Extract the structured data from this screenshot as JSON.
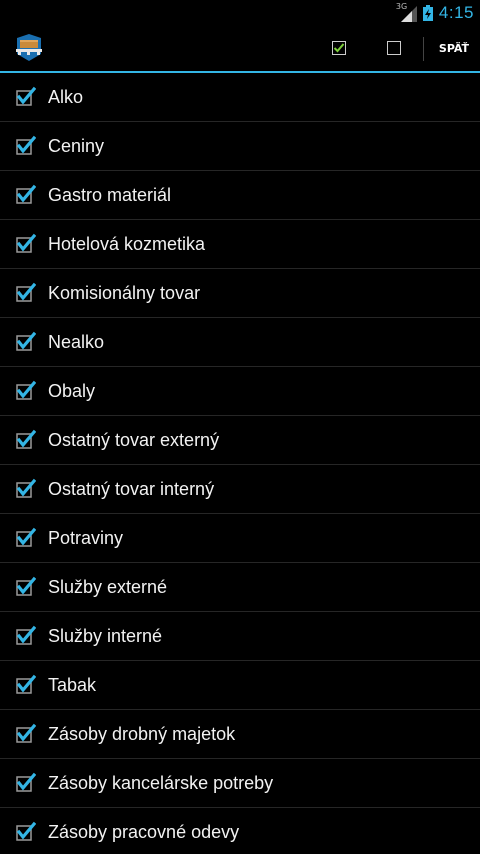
{
  "status_bar": {
    "network_label": "3G",
    "time": "4:15"
  },
  "action_bar": {
    "logo_icon": "pallet-box-icon",
    "check_all_icon": "checkbox-checked-icon",
    "uncheck_all_icon": "checkbox-empty-icon",
    "back_label": "SPÄŤ"
  },
  "colors": {
    "accent": "#33b5e5",
    "check_green": "#7dcf3a",
    "background": "#000000"
  },
  "items": [
    {
      "label": "Alko",
      "checked": true
    },
    {
      "label": "Ceniny",
      "checked": true
    },
    {
      "label": "Gastro materiál",
      "checked": true
    },
    {
      "label": "Hotelová kozmetika",
      "checked": true
    },
    {
      "label": "Komisionálny tovar",
      "checked": true
    },
    {
      "label": "Nealko",
      "checked": true
    },
    {
      "label": "Obaly",
      "checked": true
    },
    {
      "label": "Ostatný tovar externý",
      "checked": true
    },
    {
      "label": "Ostatný tovar interný",
      "checked": true
    },
    {
      "label": "Potraviny",
      "checked": true
    },
    {
      "label": "Služby externé",
      "checked": true
    },
    {
      "label": "Služby interné",
      "checked": true
    },
    {
      "label": "Tabak",
      "checked": true
    },
    {
      "label": "Zásoby drobný majetok",
      "checked": true
    },
    {
      "label": "Zásoby kancelárske potreby",
      "checked": true
    },
    {
      "label": "Zásoby pracovné odevy",
      "checked": true
    }
  ]
}
